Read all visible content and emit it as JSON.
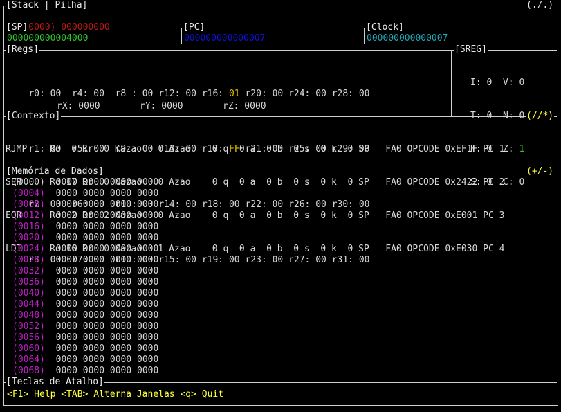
{
  "stack": {
    "title": "[Stack | Pilha]",
    "corner": "(./.)",
    "addr": "(00000)",
    "value": "000000000"
  },
  "sp": {
    "title": "[SP]",
    "value": "000000000004000"
  },
  "pc": {
    "title": "[PC]",
    "value": "000000000000007"
  },
  "clock": {
    "title": "[Clock]",
    "value": "000000000000007"
  },
  "regs": {
    "title": "[Regs]",
    "rows": [
      [
        "r0: 00",
        "r4: 00",
        "r8 : 00",
        "r12: 00",
        "r16:",
        "r20: 00",
        "r24: 00",
        "r28: 00"
      ],
      [
        "r1: 00",
        "r5: 00",
        "r9 : 00",
        "r13: 00",
        "r17:",
        "r21: 00",
        "r25: 00",
        "r29: 00"
      ],
      [
        "r2: 00",
        "r6: 00",
        "r10: 00",
        "r14: 00",
        "r18: 00",
        "r22: 00",
        "r26: 00",
        "r30: 00"
      ],
      [
        "r3: 00",
        "r7: 00",
        "r11: 00",
        "r15: 00",
        "r19: 00",
        "r23: 00",
        "r27: 00",
        "r31: 00"
      ]
    ],
    "r16_val": "01",
    "r17_val": "FF",
    "rx": "rX: 0000",
    "ry": "rY: 0000",
    "rz": "rZ: 0000"
  },
  "sreg": {
    "title": "[SREG]",
    "rows": [
      [
        "I: 0",
        "V: 0"
      ],
      [
        "T: 0",
        "N: 0"
      ],
      [
        "H: 0",
        "Z:"
      ],
      [
        "S: 0",
        "C: 0"
      ]
    ],
    "z_val": "1"
  },
  "contexto": {
    "title": "[Contexto]",
    "corner": "(//*)",
    "rows": [
      [
        "RJMP",
        "Rd  0 Rr  0 Kazao   0 Azao    0 q  0 a  0 b  0 s  0 k  0 SP   FA0 OPCODE 0xEF1F PC 1"
      ],
      [
        "SER",
        "Rd 17 Rr  0 Kazao   0 Azao    0 q  0 a  0 b  0 s  0 k  0 SP   FA0 OPCODE 0x2422 PC 2"
      ],
      [
        "EOR",
        "Rd  2 Rr  2 Kazao   0 Azao    0 q  0 a  0 b  0 s  0 k  0 SP   FA0 OPCODE 0xE001 PC 3"
      ],
      [
        "LDI",
        "Rd 16 Rr  0 Kazao   1 Azao    0 q  0 a  0 b  0 s  0 k  0 SP   FA0 OPCODE 0xE030 PC 4"
      ]
    ]
  },
  "memoria": {
    "title": "[Memória de Dados]",
    "corner": "(+/-)",
    "rows": [
      {
        "addr": "(0000)",
        "data": "0000 0000 0000 0000"
      },
      {
        "addr": "(0004)",
        "data": "0000 0000 0000 0000"
      },
      {
        "addr": "(0008)",
        "data": "0000 0000 0000 0000"
      },
      {
        "addr": "(0012)",
        "data": "0000 0000 0000 0000"
      },
      {
        "addr": "(0016)",
        "data": "0000 0000 0000 0000"
      },
      {
        "addr": "(0020)",
        "data": "0000 0000 0000 0000"
      },
      {
        "addr": "(0024)",
        "data": "0000 0000 0000 0000"
      },
      {
        "addr": "(0028)",
        "data": "0000 0000 0000 0000"
      },
      {
        "addr": "(0032)",
        "data": "0000 0000 0000 0000"
      },
      {
        "addr": "(0036)",
        "data": "0000 0000 0000 0000"
      },
      {
        "addr": "(0040)",
        "data": "0000 0000 0000 0000"
      },
      {
        "addr": "(0044)",
        "data": "0000 0000 0000 0000"
      },
      {
        "addr": "(0048)",
        "data": "0000 0000 0000 0000"
      },
      {
        "addr": "(0052)",
        "data": "0000 0000 0000 0000"
      },
      {
        "addr": "(0056)",
        "data": "0000 0000 0000 0000"
      },
      {
        "addr": "(0060)",
        "data": "0000 0000 0000 0000"
      },
      {
        "addr": "(0064)",
        "data": "0000 0000 0000 0000"
      },
      {
        "addr": "(0068)",
        "data": "0000 0000 0000 0000"
      }
    ]
  },
  "teclas": {
    "title": "[Teclas de Atalho]",
    "shortcuts": "<F1> Help <TAB> Alterna Janelas <q> Quit"
  },
  "colors": {
    "stack_value": "#c01818",
    "sp_value": "#2ec82e",
    "pc_value": "#1010e0",
    "clock_value": "#20a8b8",
    "highlight": "#e0c000",
    "mem_addr": "#c020c8",
    "shortcuts": "#ffff40"
  }
}
